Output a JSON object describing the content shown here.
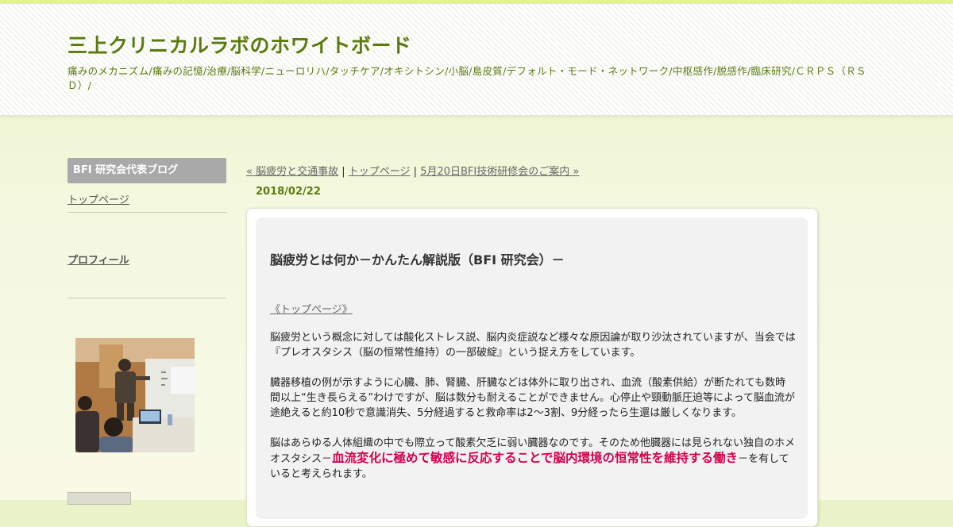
{
  "header": {
    "title": "三上クリニカルラボのホワイトボード",
    "description": "痛みのメカニズム/痛みの記憶/治療/脳科学/ニューロリハ/タッチケア/オキシトシン/小脳/島皮質/デフォルト・モード・ネットワーク/中枢感作/脱感作/臨床研究/ＣＲＰＳ（ＲＳＤ）/"
  },
  "sidebar": {
    "heading": "BFI 研究会代表ブログ",
    "top_page": "トップページ",
    "profile": "プロフィール"
  },
  "nav": {
    "prev": "« 脳疲労と交通事故",
    "separator": "|",
    "home": "トップページ",
    "next": "5月20日BFI技術研修会のご案内 »"
  },
  "post": {
    "date": "2018/02/22",
    "title": "脳疲労とは何か－かんたん解説版（BFI 研究会）－",
    "top_link": "《トップページ》",
    "p1": "脳疲労という概念に対しては酸化ストレス説、脳内炎症説など様々な原因論が取り沙汰されていますが、当会では『プレオスタシス（脳の恒常性維持）の一部破綻』という捉え方をしています。",
    "p2": "臓器移植の例が示すように心臓、肺、腎臓、肝臓などは体外に取り出され、血流（酸素供給）が断たれても数時間以上“生き長らえる”わけですが、脳は数分も耐えることができません。心停止や頸動脈圧迫等によって脳血流が途絶えると約10秒で意識消失、5分経過すると救命率は2～3割、9分経ったら生還は厳しくなります。",
    "p3_before": "脳はあらゆる人体組織の中でも際立って酸素欠乏に弱い臓器なのです。そのため他臓器には見られない独自のホメオスタシス－",
    "p3_highlight": "血流変化に極めて敏感に反応することで脳内環境の恒常性を維持する働き",
    "p3_after": "－を有していると考えられます。"
  },
  "colors": {
    "accent_green": "#5b7b0e",
    "highlight_red": "#d4004c",
    "sidebar_heading_bg": "#a9a9a9"
  }
}
